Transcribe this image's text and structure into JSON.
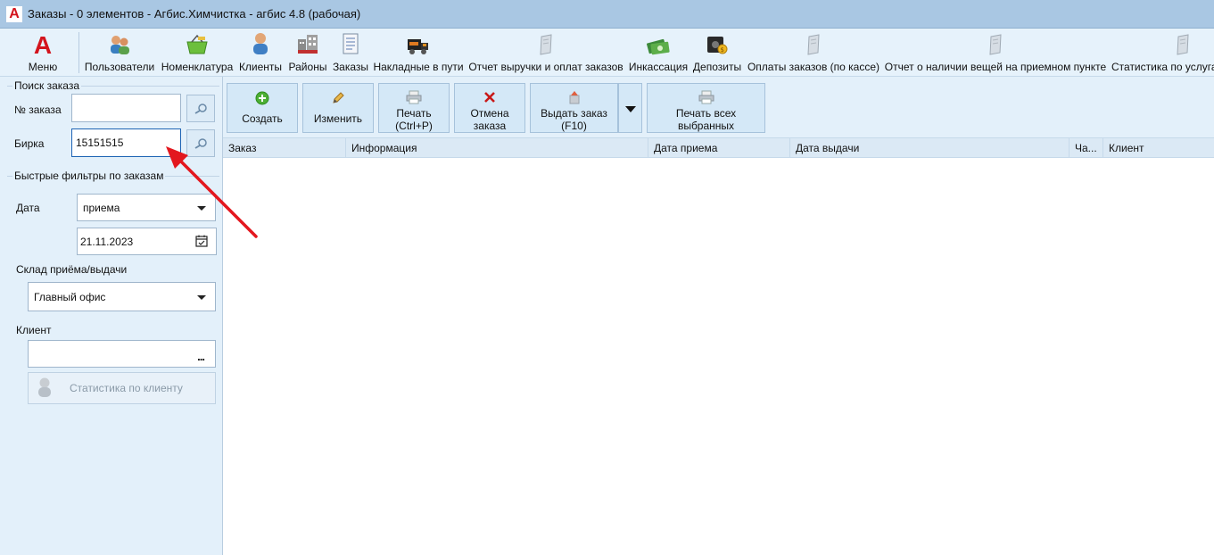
{
  "window": {
    "title": "Заказы - 0 элементов - Агбис.Химчистка - агбис 4.8 (рабочая)",
    "logo_letter": "A"
  },
  "ribbon": {
    "menu_logo": "A",
    "menu_label": "Меню",
    "items": [
      {
        "label": "Пользователи",
        "icon": "users-icon"
      },
      {
        "label": "Номенклатура",
        "icon": "basket-icon"
      },
      {
        "label": "Клиенты",
        "icon": "client-icon"
      },
      {
        "label": "Районы",
        "icon": "buildings-icon"
      },
      {
        "label": "Заказы",
        "icon": "document-icon"
      },
      {
        "label": "Накладные в пути",
        "icon": "truck-icon"
      },
      {
        "label": "Отчет выручки и оплат заказов",
        "icon": "report-icon"
      },
      {
        "label": "Инкассация",
        "icon": "money-icon"
      },
      {
        "label": "Депозиты",
        "icon": "safe-icon"
      },
      {
        "label": "Оплаты заказов (по кассе)",
        "icon": "report-icon"
      },
      {
        "label": "Отчет о наличии вещей на приемном пункте",
        "icon": "report-icon"
      },
      {
        "label": "Статистика по услуга",
        "icon": "report-icon"
      }
    ]
  },
  "search": {
    "group_title": "Поиск заказа",
    "order_number_label": "№ заказа",
    "order_number_value": "",
    "tag_label": "Бирка",
    "tag_value": "15151515"
  },
  "filters": {
    "group_title": "Быстрые фильтры по заказам",
    "date_label": "Дата",
    "date_type_value": "приема",
    "date_value": "21.11.2023",
    "warehouse_label": "Склад приёма/выдачи",
    "warehouse_value": "Главный офис",
    "client_label": "Клиент",
    "client_value": "",
    "client_dots": "...",
    "client_stats_label": "Статистика по клиенту"
  },
  "actions": {
    "create": "Создать",
    "edit": "Изменить",
    "print_line1": "Печать",
    "print_line2": "(Ctrl+P)",
    "cancel_line1": "Отмена",
    "cancel_line2": "заказа",
    "issue_line1": "Выдать заказ",
    "issue_line2": "(F10)",
    "print_all_line1": "Печать всех",
    "print_all_line2": "выбранных"
  },
  "grid": {
    "columns": [
      "Заказ",
      "Информация",
      "Дата приема",
      "Дата выдачи",
      "Ча...",
      "Клиент"
    ],
    "rows": []
  },
  "colors": {
    "brand_red": "#d3141d",
    "title_bar": "#a9c7e3",
    "panel_bg": "#e3f0fa",
    "annotation_arrow": "#e3171e"
  }
}
